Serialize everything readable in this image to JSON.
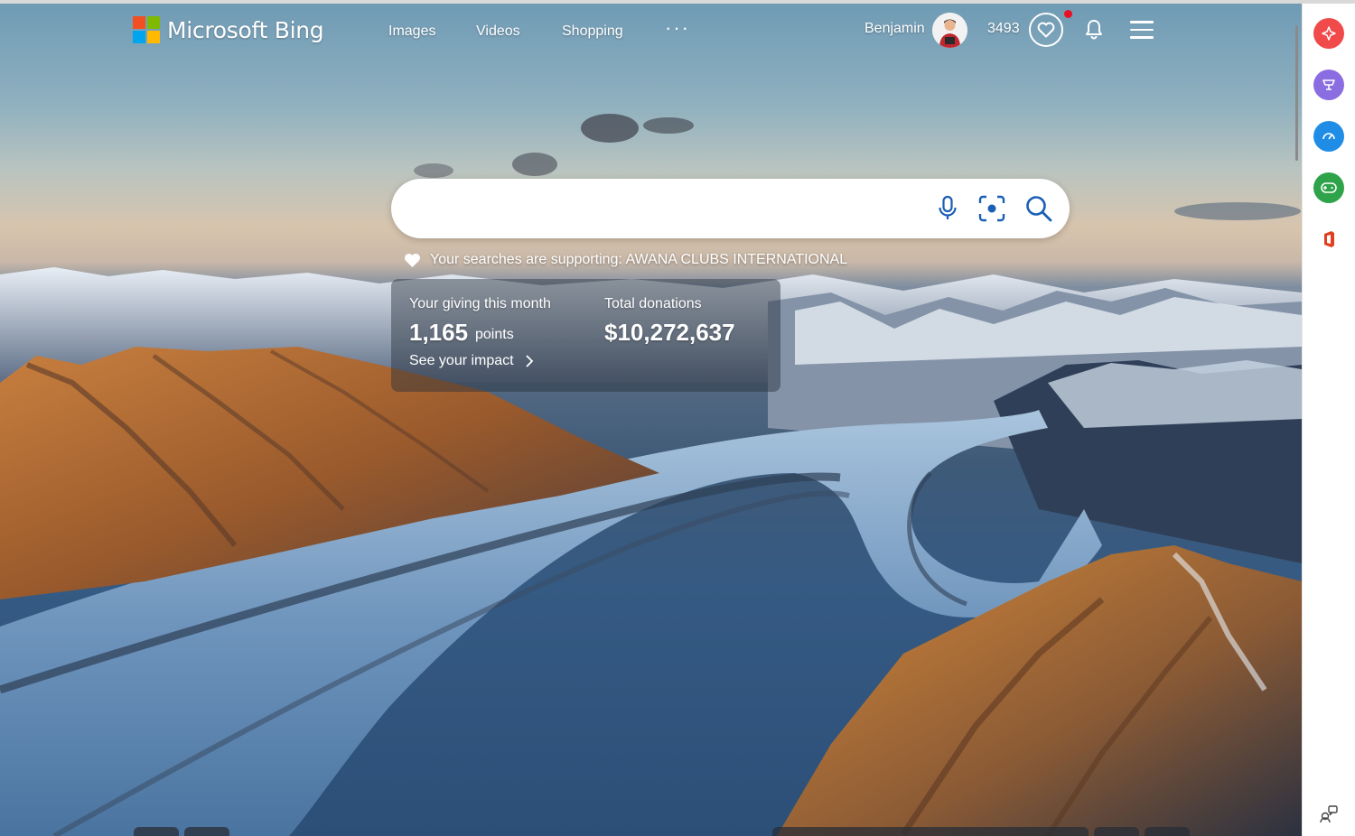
{
  "header": {
    "logo_text": "Microsoft Bing",
    "nav": [
      {
        "label": "Images"
      },
      {
        "label": "Videos"
      },
      {
        "label": "Shopping"
      }
    ],
    "more_label": "···",
    "user_name": "Benjamin",
    "rewards_points": "3493"
  },
  "search": {
    "value": "",
    "placeholder": "",
    "icons": [
      "microphone-icon",
      "visual-search-icon",
      "search-icon"
    ]
  },
  "charity": {
    "supporting_text": "Your searches are supporting: AWANA CLUBS INTERNATIONAL",
    "giving_label": "Your giving this month",
    "giving_value": "1,165",
    "giving_unit": "points",
    "donations_label": "Total donations",
    "donations_value": "$10,272,637",
    "impact_link": "See your impact"
  },
  "sidebar": {
    "items": [
      {
        "name": "copilot-icon",
        "color": "#f04a4a"
      },
      {
        "name": "shopping-icon",
        "color": "#8a6de0"
      },
      {
        "name": "tools-icon",
        "color": "#1f8de6"
      },
      {
        "name": "games-icon",
        "color": "#2ea34a"
      },
      {
        "name": "office-icon",
        "color": "#e0401f"
      }
    ],
    "bottom_icon": "feedback-icon"
  },
  "colors": {
    "accent_red": "#e81123",
    "search_icon_blue": "#1a5fb4"
  }
}
